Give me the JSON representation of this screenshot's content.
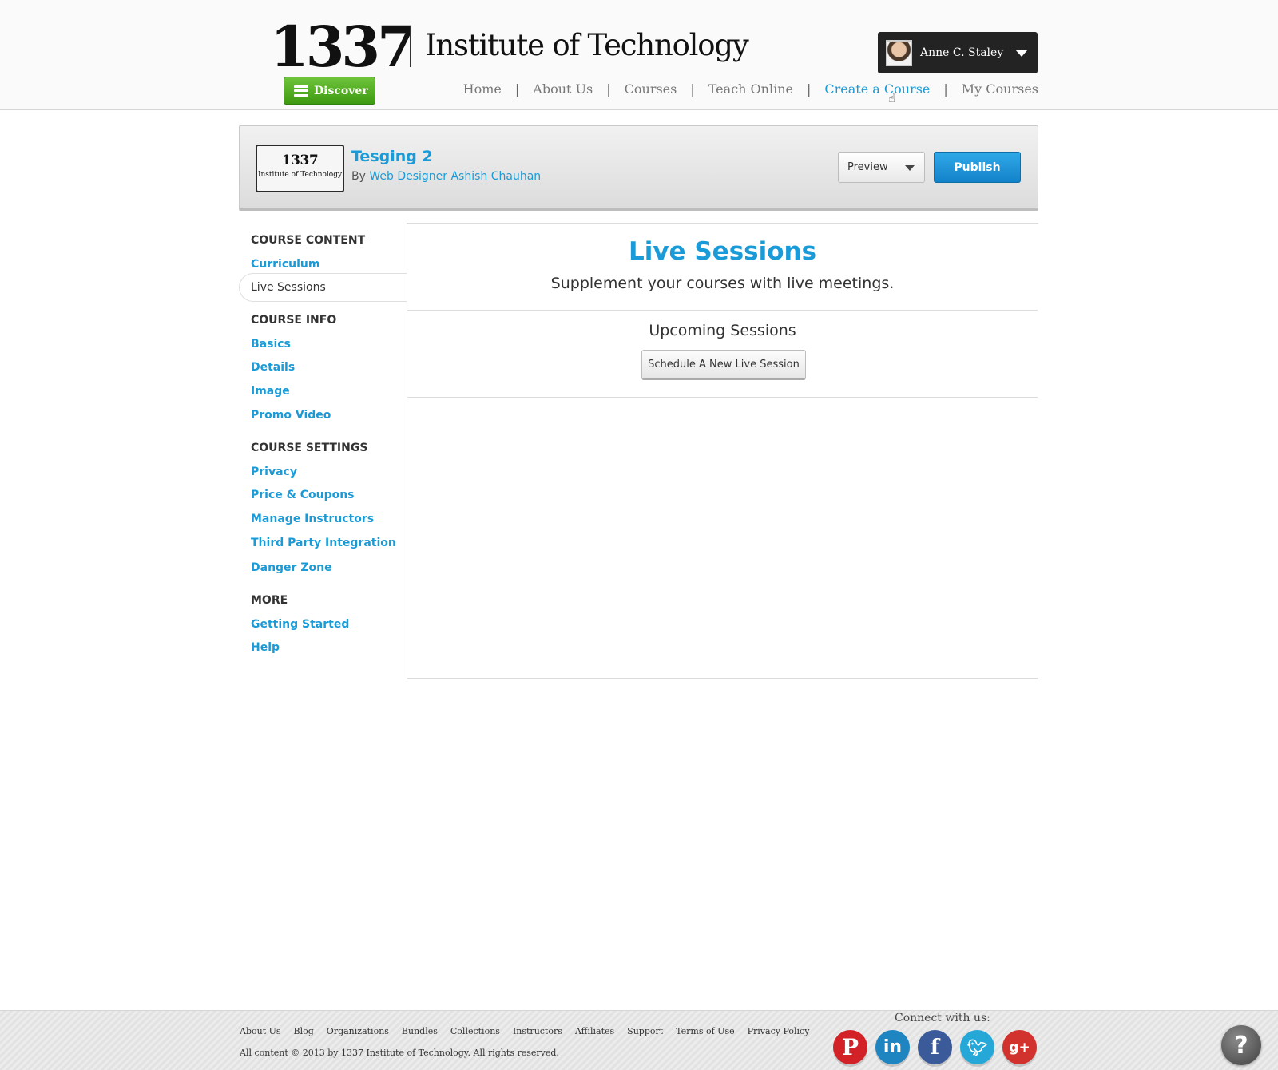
{
  "header": {
    "logo_number": "1337",
    "logo_name": "Institute of Technology",
    "discover_label": "Discover",
    "user_name": "Anne C. Staley",
    "nav": [
      "Home",
      "About Us",
      "Courses",
      "Teach Online",
      "Create a Course",
      "My Courses"
    ],
    "nav_active": "Create a Course"
  },
  "course": {
    "thumb_number": "1337",
    "thumb_name": "Institute of Technology",
    "title": "Tesging 2",
    "by_prefix": "By",
    "author": "Web Designer Ashish Chauhan",
    "preview_label": "Preview",
    "publish_label": "Publish"
  },
  "sidebar": {
    "content_heading": "COURSE CONTENT",
    "curriculum": "Curriculum",
    "live_sessions": "Live Sessions",
    "info_heading": "COURSE INFO",
    "basics": "Basics",
    "details": "Details",
    "image": "Image",
    "promo_video": "Promo Video",
    "settings_heading": "COURSE SETTINGS",
    "privacy": "Privacy",
    "price_coupons": "Price & Coupons",
    "manage_instructors": "Manage Instructors",
    "third_party": "Third Party Integration",
    "danger_zone": "Danger Zone",
    "more_heading": "MORE",
    "getting_started": "Getting Started",
    "help": "Help"
  },
  "main": {
    "title": "Live Sessions",
    "subtitle": "Supplement your courses with live meetings.",
    "upcoming_heading": "Upcoming Sessions",
    "schedule_label": "Schedule A New Live Session"
  },
  "footer": {
    "links": [
      "About Us",
      "Blog",
      "Organizations",
      "Bundles",
      "Collections",
      "Instructors",
      "Affiliates",
      "Support",
      "Terms of Use",
      "Privacy Policy"
    ],
    "copyright": "All content © 2013 by 1337 Institute of Technology. All rights reserved.",
    "connect": "Connect with us:",
    "socials": [
      "pinterest-icon",
      "linkedin-icon",
      "facebook-icon",
      "twitter-icon",
      "google-plus-icon"
    ],
    "help_symbol": "?"
  },
  "colors": {
    "accent": "#1a9bd7",
    "discover_green": "#4aaa1c",
    "publish_blue": "#1b8fd3",
    "user_box": "#232323"
  }
}
